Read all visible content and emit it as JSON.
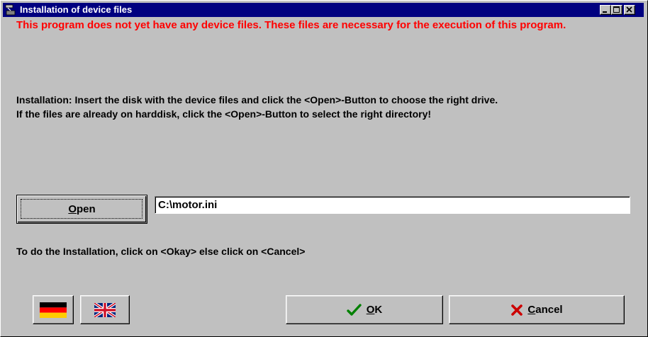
{
  "window": {
    "title": "Installation of device files"
  },
  "messages": {
    "warning": "This program does not yet have any device files. These files are necessary for the execution of this program.",
    "instructions_line1": "Installation: Insert the disk with the device files and click the <Open>-Button to choose the right drive.",
    "instructions_line2": "If the files are already on harddisk, click the <Open>-Button to select the right directory!",
    "hint": "To do the Installation, click on <Okay> else click on <Cancel>"
  },
  "open_button": {
    "accel": "O",
    "rest": "pen"
  },
  "path_field": {
    "value": "C:\\motor.ini"
  },
  "ok_button": {
    "accel": "O",
    "rest": "K",
    "icon": "check-icon"
  },
  "cancel_button": {
    "accel": "C",
    "rest": "ancel",
    "icon": "x-icon"
  },
  "language": {
    "german_icon": "german-flag-icon",
    "english_icon": "uk-flag-icon"
  },
  "colors": {
    "warning_text": "#ff0000",
    "titlebar": "#000080",
    "window_bg": "#c0c0c0"
  }
}
